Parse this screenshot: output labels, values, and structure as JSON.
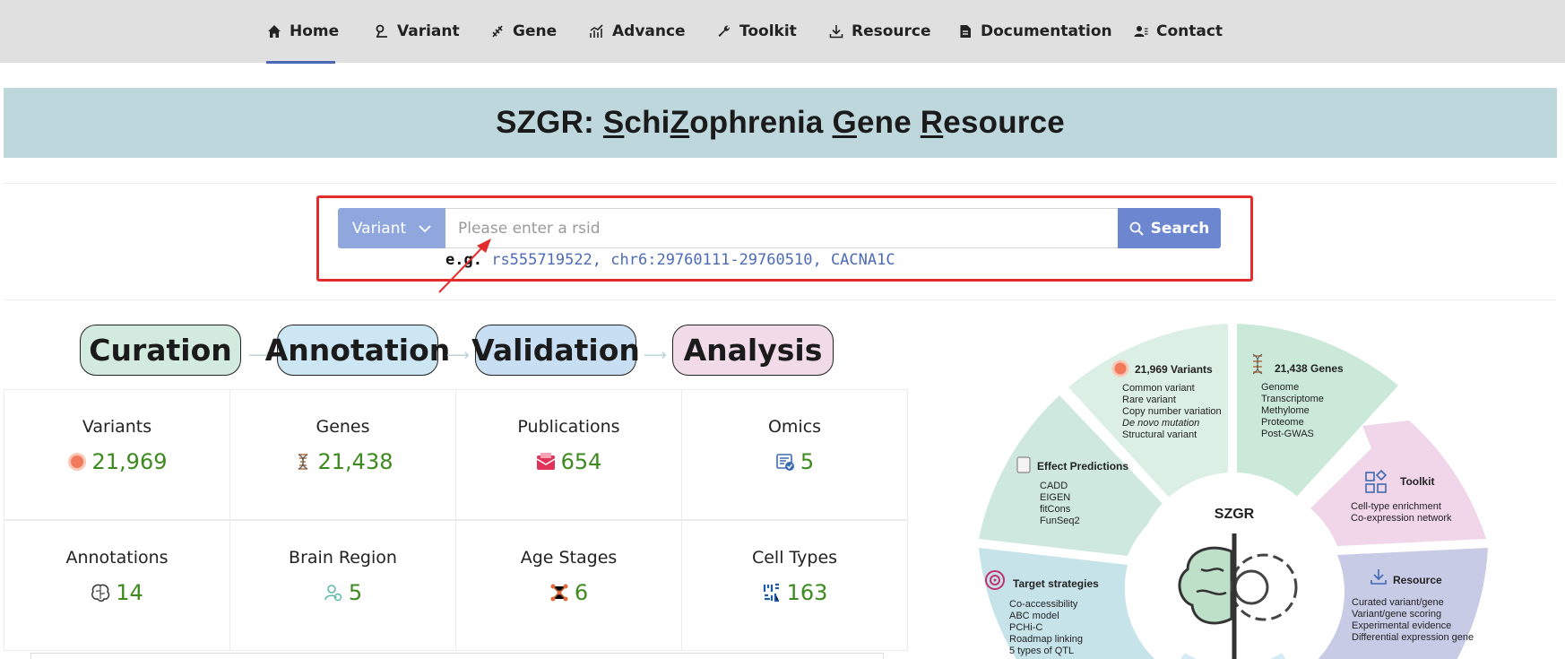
{
  "nav": {
    "items": [
      {
        "label": "Home",
        "icon": "home-icon"
      },
      {
        "label": "Variant",
        "icon": "variant-icon"
      },
      {
        "label": "Gene",
        "icon": "gene-icon"
      },
      {
        "label": "Advance",
        "icon": "advance-icon"
      },
      {
        "label": "Toolkit",
        "icon": "wrench-icon"
      },
      {
        "label": "Resource",
        "icon": "download-icon"
      },
      {
        "label": "Documentation",
        "icon": "document-icon"
      },
      {
        "label": "Contact",
        "icon": "contact-icon"
      }
    ],
    "active": "Home"
  },
  "banner": {
    "parts": [
      "SZGR: ",
      "S",
      "chi",
      "Z",
      "ophrenia ",
      "G",
      "ene ",
      "R",
      "esource"
    ]
  },
  "search": {
    "select_value": "Variant",
    "placeholder": "Please enter a rsid",
    "button_label": "Search",
    "example_label": "e.g.",
    "examples": [
      "rs555719522,",
      "chr6:29760111-29760510,",
      "CACNA1C"
    ]
  },
  "pipeline": [
    "Curation",
    "Annotation",
    "Validation",
    "Analysis"
  ],
  "stats": [
    {
      "label": "Variants",
      "value": "21,969",
      "icon": "variant-dot-icon"
    },
    {
      "label": "Genes",
      "value": "21,438",
      "icon": "dna-icon"
    },
    {
      "label": "Publications",
      "value": "654",
      "icon": "mail-icon"
    },
    {
      "label": "Omics",
      "value": "5",
      "icon": "omics-icon"
    },
    {
      "label": "Annotations",
      "value": "14",
      "icon": "brain-icon"
    },
    {
      "label": "Brain Region",
      "value": "5",
      "icon": "region-icon"
    },
    {
      "label": "Age Stages",
      "value": "6",
      "icon": "network-icon"
    },
    {
      "label": "Cell Types",
      "value": "163",
      "icon": "celltype-icon"
    }
  ],
  "wheel": {
    "center": "SZGR",
    "variants": {
      "title": "21,969 Variants",
      "items": [
        "Common variant",
        "Rare variant",
        "Copy number variation",
        "De novo mutation",
        "Structural variant"
      ]
    },
    "genes": {
      "title": "21,438 Genes",
      "items": [
        "Genome",
        "Transcriptome",
        "Methylome",
        "Proteome",
        "Post-GWAS"
      ]
    },
    "toolkit": {
      "title": "Toolkit",
      "items": [
        "Cell-type enrichment",
        "Co-expression network"
      ]
    },
    "resource": {
      "title": "Resource",
      "items": [
        "Curated variant/gene",
        "Variant/gene scoring",
        "Experimental evidence",
        "Differential expression gene"
      ]
    },
    "effect": {
      "title": "Effect Predictions",
      "items": [
        "CADD",
        "EIGEN",
        "fitCons",
        "FunSeq2"
      ]
    },
    "target": {
      "title": "Target strategies",
      "items": [
        "Co-accessibility",
        "ABC model",
        "PCHi-C",
        "Roadmap linking",
        "5 types of  QTL"
      ]
    },
    "colors": {
      "variants": "#dcefe5",
      "genes": "#cbe9d8",
      "toolkit": "#f0d6e8",
      "resource": "#c8cbe6",
      "effect": "#cfe8df",
      "target": "#c7e3ea"
    }
  },
  "colors": {
    "accent": "#6c87cf",
    "select": "#8fa7dc",
    "highlight": "#e32c2c",
    "value": "#3d8a1f",
    "banner": "#bdd7dc"
  }
}
